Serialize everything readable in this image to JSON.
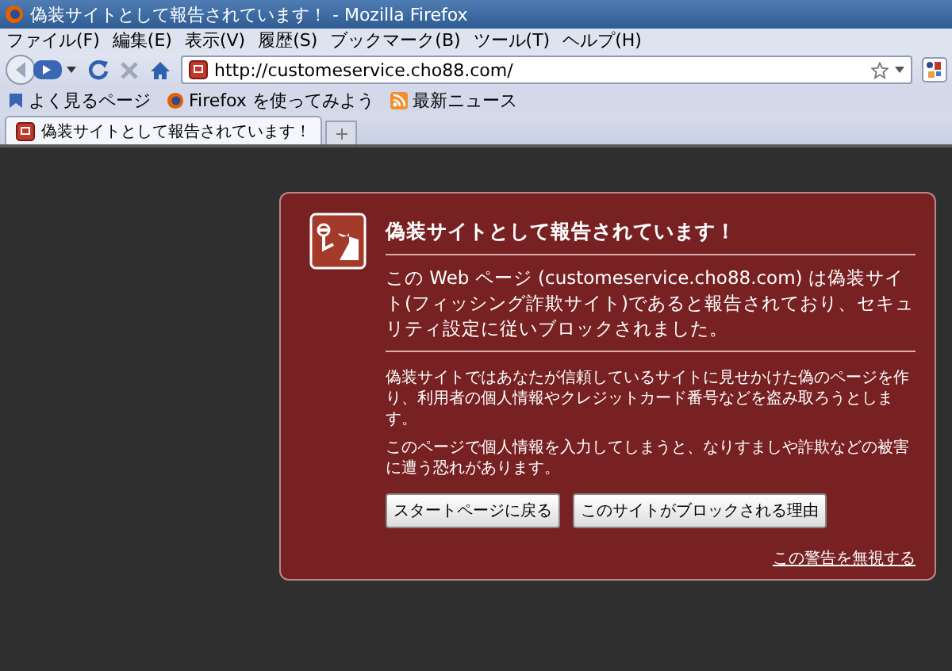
{
  "window": {
    "title": "偽装サイトとして報告されています！ - Mozilla Firefox"
  },
  "menu": [
    "ファイル(F)",
    "編集(E)",
    "表示(V)",
    "履歴(S)",
    "ブックマーク(B)",
    "ツール(T)",
    "ヘルプ(H)"
  ],
  "toolbar": {
    "url": "http://customeservice.cho88.com/"
  },
  "bookmarks": [
    {
      "kind": "folder",
      "label": "よく見るページ"
    },
    {
      "kind": "firefox",
      "label": "Firefox を使ってみよう"
    },
    {
      "kind": "feed",
      "label": "最新ニュース"
    }
  ],
  "tabs": [
    {
      "label": "偽装サイトとして報告されています！",
      "selected": true
    }
  ],
  "warning": {
    "title": "偽装サイトとして報告されています！",
    "lead": "この Web ページ (customeservice.cho88.com) は偽装サイト(フィッシング詐欺サイト)であると報告されており、セキュリティ設定に従いブロックされました。",
    "paragraphs": [
      "偽装サイトではあなたが信頼しているサイトに見せかけた偽のページを作り、利用者の個人情報やクレジットカード番号などを盗み取ろうとします。",
      "このページで個人情報を入力してしまうと、なりすましや詐欺などの被害に遭う恐れがあります。"
    ],
    "buttons": [
      "スタートページに戻る",
      "このサイトがブロックされる理由"
    ],
    "ignore_link": "この警告を無視する"
  }
}
